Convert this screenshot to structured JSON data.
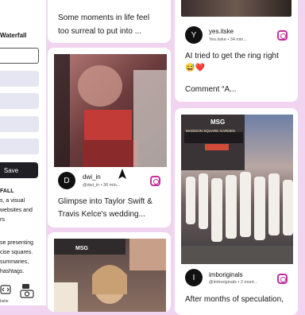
{
  "sidebar": {
    "title": "Waterfall",
    "save_label": "Save",
    "desc_heading": "FALL",
    "desc_lines": [
      "s, a visual",
      "websites and",
      "rs"
    ],
    "desc2_lines": [
      "se presenting",
      "cise squares.",
      "summaries,",
      "hashtags."
    ],
    "mini_caption": "bsite"
  },
  "cards": [
    {
      "caption": [
        "Some moments in life feel",
        "too surreal to put into ..."
      ]
    },
    {
      "user": "yes.itske",
      "meta": "Yes.itske • 34 min...",
      "avatar_letter": "Y",
      "caption": [
        "AI tried to get the ring right",
        "😅❤️",
        "",
        "Comment “A..."
      ]
    },
    {
      "user": "dwi_in",
      "meta": "@dwi_in • 36 min...",
      "avatar_letter": "D",
      "caption": [
        "Glimpse into Taylor Swift &",
        "Travis Kelce's wedding..."
      ]
    },
    {
      "user": "imboriginals",
      "meta": "@imboriginals • 2 mont...",
      "avatar_letter": "I",
      "photo_sign": "MSG",
      "photo_marquee": "MADISON SQUARE GARDEN",
      "caption": [
        "After months of speculation,"
      ]
    },
    {
      "photo_sign": "MSG"
    }
  ],
  "colors": {
    "background": "#f1d4f0",
    "instagram": "#c42fa0",
    "button": "#1e1e24"
  }
}
